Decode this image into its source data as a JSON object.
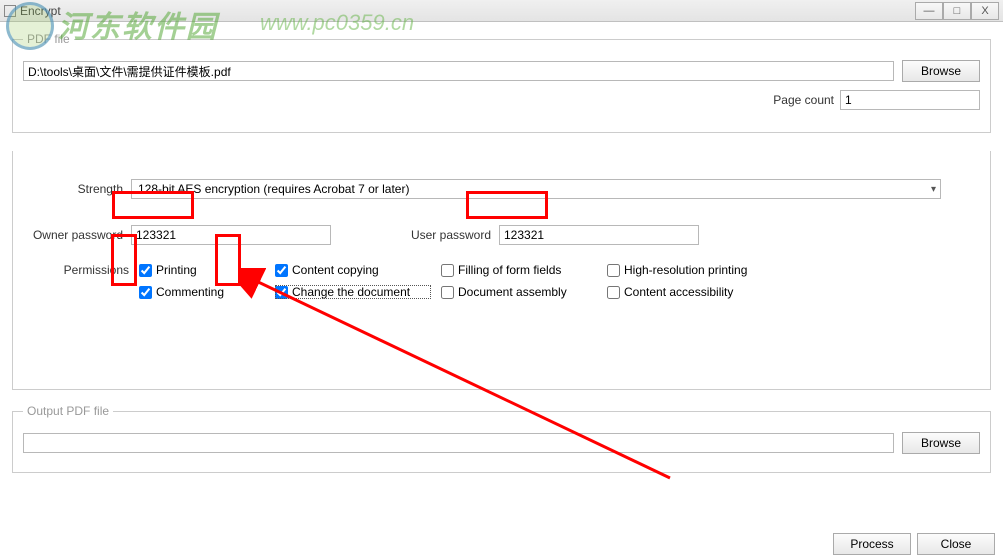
{
  "window": {
    "title": "Encrypt",
    "minimize": "—",
    "maximize": "□",
    "close": "X"
  },
  "pdf_file": {
    "legend": "PDF file",
    "path": "D:\\tools\\桌面\\文件\\需提供证件模板.pdf",
    "browse": "Browse",
    "page_count_label": "Page count",
    "page_count_value": "1"
  },
  "encryption": {
    "strength_label": "Strength",
    "strength_value": "128-bit AES encryption (requires Acrobat 7 or later)",
    "owner_pw_label": "Owner password",
    "owner_pw_value": "123321",
    "user_pw_label": "User password",
    "user_pw_value": "123321",
    "permissions_label": "Permissions",
    "perms": {
      "printing": "Printing",
      "content_copying": "Content copying",
      "filling": "Filling of form fields",
      "highres": "High-resolution printing",
      "commenting": "Commenting",
      "change_doc": "Change the document",
      "assembly": "Document assembly",
      "accessibility": "Content accessibility"
    }
  },
  "output": {
    "legend": "Output PDF file",
    "path": "",
    "browse": "Browse"
  },
  "buttons": {
    "process": "Process",
    "close": "Close"
  },
  "watermark": {
    "text": "河东软件园",
    "url": "www.pc0359.cn"
  }
}
